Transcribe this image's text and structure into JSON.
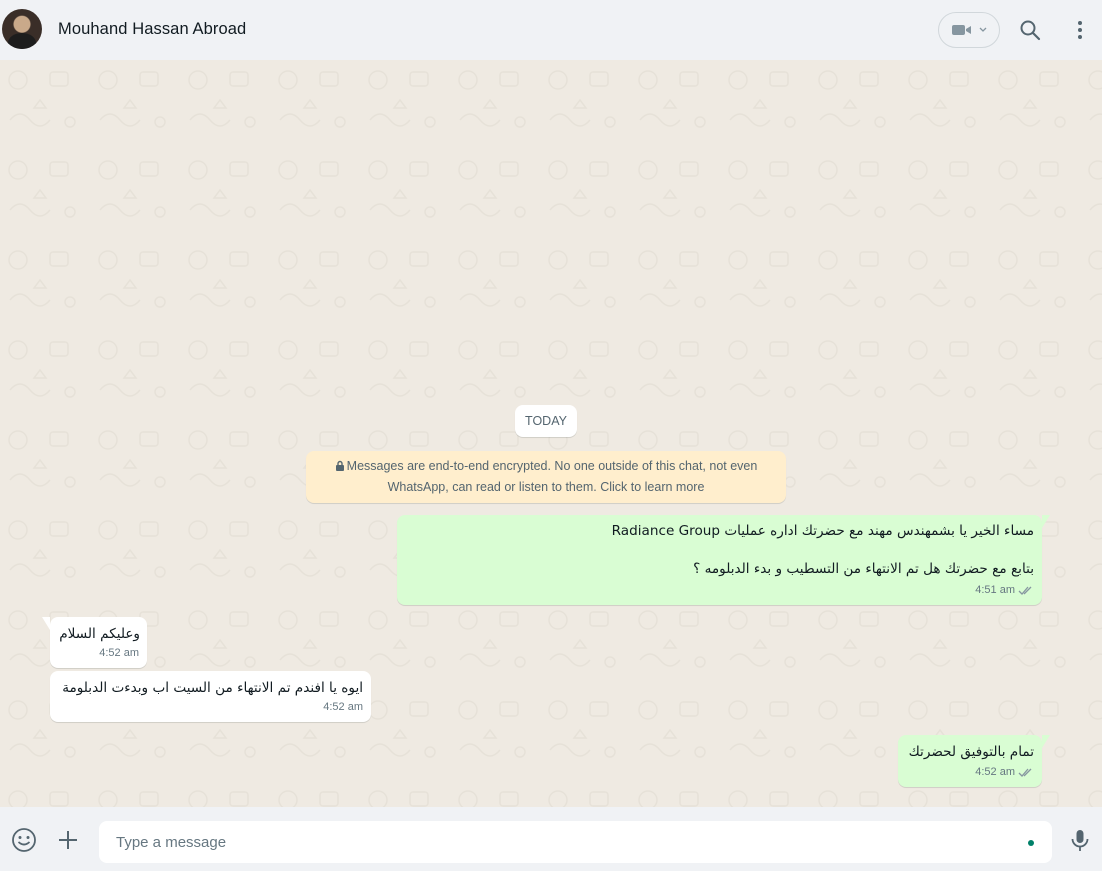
{
  "header": {
    "contact_name": "Mouhand Hassan Abroad"
  },
  "chat": {
    "day_label": "TODAY",
    "encryption_notice_line1": "Messages are end-to-end encrypted. No one outside of this chat, not even",
    "encryption_notice_line2": "WhatsApp, can read or listen to them. Click to learn more",
    "messages": [
      {
        "direction": "outgoing",
        "line1": "مساء الخير يا بشمهندس مهند مع  حضرتك اداره عمليات Radiance Group",
        "line2": "بتابع مع حضرتك هل تم الانتهاء من التسطيب و بدء الدبلومه ؟",
        "time": "4:51 am",
        "status": "read"
      },
      {
        "direction": "incoming",
        "text": "وعليكم السلام",
        "time": "4:52 am"
      },
      {
        "direction": "incoming",
        "text": "ايوه يا افندم تم الانتهاء من السيت اب وبدءت الدبلومة",
        "time": "4:52 am"
      },
      {
        "direction": "outgoing",
        "text": "تمام بالتوفيق لحضرتك",
        "time": "4:52 am",
        "status": "read"
      }
    ]
  },
  "composer": {
    "placeholder": "Type a message"
  },
  "icons": {
    "video": "video-call-icon",
    "search": "search-icon",
    "menu": "more-vertical-icon",
    "emoji": "emoji-icon",
    "attach": "plus-icon",
    "mic": "microphone-icon",
    "lock": "lock-icon",
    "ticks": "double-check-icon"
  },
  "colors": {
    "outgoing_bubble": "#d9fdd3",
    "incoming_bubble": "#ffffff",
    "notice_bg": "#ffeecd",
    "read_ticks": "#8696a0",
    "accent": "#008069"
  }
}
